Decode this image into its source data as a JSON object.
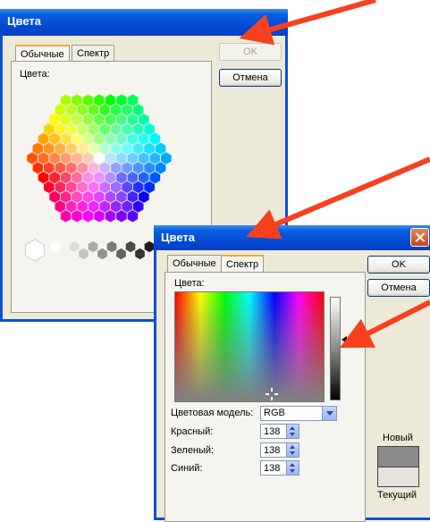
{
  "dialog1": {
    "title": "Цвета",
    "tabs": [
      {
        "label": "Обычные"
      },
      {
        "label": "Спектр"
      }
    ],
    "colors_label": "Цвета:",
    "ok_label": "OK",
    "cancel_label": "Отмена"
  },
  "dialog2": {
    "title": "Цвета",
    "tabs": [
      {
        "label": "Обычные"
      },
      {
        "label": "Спектр"
      }
    ],
    "colors_label": "Цвета:",
    "ok_label": "OK",
    "cancel_label": "Отмена",
    "color_model_label": "Цветовая модель:",
    "color_model_value": "RGB",
    "red_label": "Красный:",
    "green_label": "Зеленый:",
    "blue_label": "Синий:",
    "red_value": "138",
    "green_value": "138",
    "blue_value": "138",
    "new_label": "Новый",
    "current_label": "Текущий",
    "new_color": "#8a8a8a",
    "current_color": "#e6e3dc"
  },
  "palette": {
    "accent": "#0b4fd6",
    "arrow_color": "#f5411f",
    "grays": [
      "#ffffff",
      "#f2f2f2",
      "#dcdcdc",
      "#c4c4c4",
      "#aaaaaa",
      "#929292",
      "#7a7a7a",
      "#626262",
      "#4a4a4a",
      "#333333",
      "#1c1c1c"
    ]
  }
}
